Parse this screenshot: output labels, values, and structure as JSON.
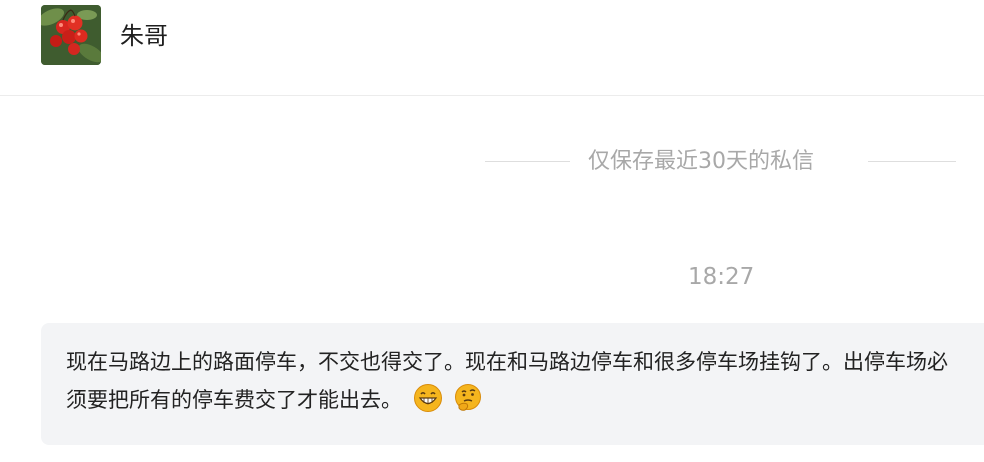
{
  "header": {
    "contact_name": "朱哥",
    "avatar_icon": "cherry-photo-avatar"
  },
  "conversation": {
    "retention_notice": "仅保存最近30天的私信",
    "timestamp": "18:27",
    "message": {
      "text": "现在马路边上的路面停车，不交也得交了。现在和马路边停车和很多停车场挂钩了。出停车场必须要把所有的停车费交了才能出去。",
      "emojis": [
        "grinning-face-emoji",
        "thinking-face-emoji"
      ]
    }
  },
  "colors": {
    "bubble_bg": "#f3f4f6",
    "muted_text": "#a8a8a8",
    "emoji_yellow": "#f5b51e"
  }
}
